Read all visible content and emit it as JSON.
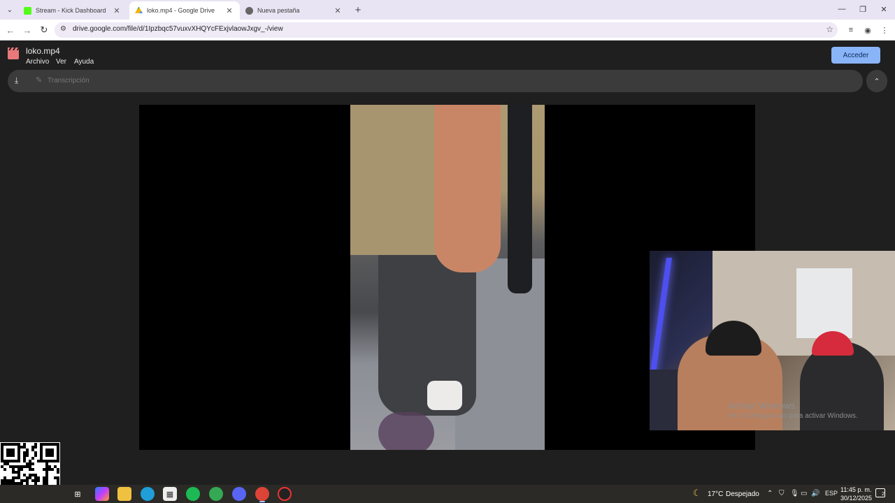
{
  "browser": {
    "tabs": [
      {
        "title": "Stream - Kick Dashboard",
        "favicon": "kick-icon",
        "active": false
      },
      {
        "title": "loko.mp4 - Google Drive",
        "favicon": "google-drive-icon",
        "active": true
      },
      {
        "title": "Nueva pestaña",
        "favicon": "chrome-icon",
        "active": false
      }
    ],
    "url": "drive.google.com/file/d/1Ipzbqc57vuxvXHQYcFExjvlaowJxgv_-/view"
  },
  "drive": {
    "file_name": "loko.mp4",
    "menu": [
      "Archivo",
      "Ver",
      "Ayuda"
    ],
    "login_label": "Acceder",
    "transcript_label": "Transcripción"
  },
  "watermark": {
    "title": "Activar Windows",
    "subtitle": "Ve a Configuración para activar Windows."
  },
  "taskbar": {
    "weather_temp": "17°C",
    "weather_desc": "Despejado",
    "language": "ESP",
    "time": "11:45 p. m.",
    "date": "30/12/2025",
    "notifications": "2"
  },
  "colors": {
    "accent": "#8ab4f8",
    "viewer_bg": "#1f1f1f",
    "taskbar_bg": "#2b2a26"
  }
}
